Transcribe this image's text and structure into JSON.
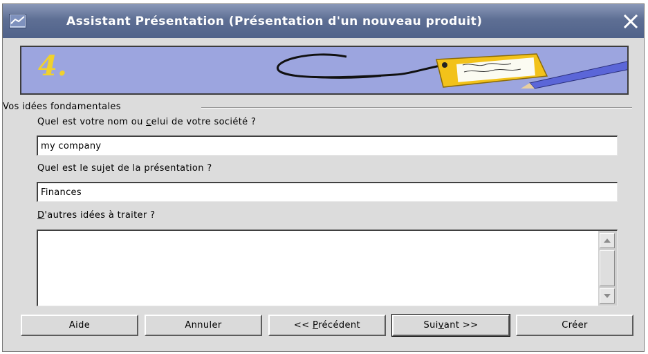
{
  "window": {
    "title": "Assistant Présentation (Présentation d'un nouveau produit)",
    "icon": "presentation-app-icon",
    "close_icon": "close-icon"
  },
  "banner": {
    "step": "4.",
    "graphic": "tag-with-pencil-illustration",
    "colors": {
      "background": "#9ca5df",
      "step_number": "#f0d12d"
    }
  },
  "group": {
    "title": "Vos idées fondamentales"
  },
  "fields": {
    "company": {
      "label_before": "Quel est votre nom ou ",
      "label_key": "c",
      "label_after": "elui de votre société ?",
      "value": "my company"
    },
    "topic": {
      "label_before": "Quel est le su",
      "label_key": "j",
      "label_after": "et de la présentation ?",
      "value": "Finances"
    },
    "ideas": {
      "label_key": "D",
      "label_after": "'autres idées à traiter ?",
      "value": ""
    }
  },
  "buttons": {
    "help": "Aide",
    "cancel": "Annuler",
    "back_prefix": "<< ",
    "back_key": "P",
    "back_rest": "récédent",
    "next_before": "Sui",
    "next_key": "v",
    "next_after": "ant >>",
    "create": "Créer"
  }
}
